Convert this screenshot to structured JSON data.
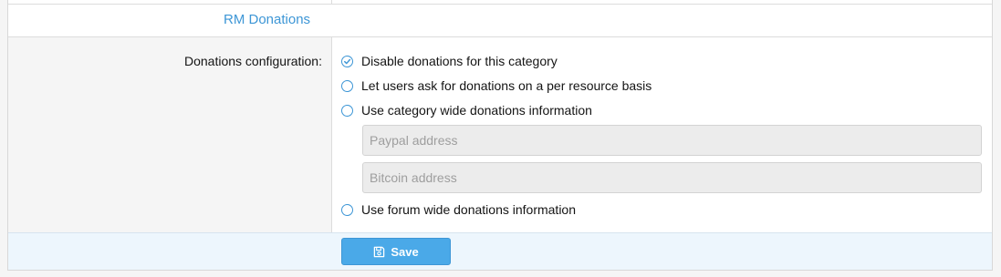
{
  "section": {
    "title": "RM Donations"
  },
  "form": {
    "label": "Donations configuration:",
    "options": [
      {
        "label": "Disable donations for this category",
        "checked": true
      },
      {
        "label": "Let users ask for donations on a per resource basis",
        "checked": false
      },
      {
        "label": "Use category wide donations information",
        "checked": false
      },
      {
        "label": "Use forum wide donations information",
        "checked": false
      }
    ],
    "paypal": {
      "placeholder": "Paypal address",
      "value": ""
    },
    "bitcoin": {
      "placeholder": "Bitcoin address",
      "value": ""
    }
  },
  "footer": {
    "save_label": "Save",
    "save_icon": "save-icon"
  },
  "colors": {
    "accent": "#3d96d6",
    "button": "#4aa9e8",
    "footer_bg": "#edf6fd",
    "label_bg": "#f5f5f5"
  }
}
